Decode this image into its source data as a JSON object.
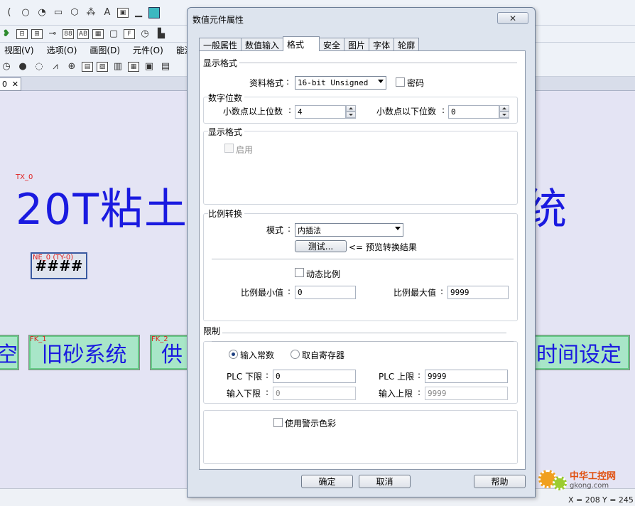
{
  "app": {
    "menu": [
      "视图(V)",
      "选项(O)",
      "画图(D)",
      "元件(O)",
      "能源管理"
    ],
    "tab": {
      "label": "0",
      "close": "✕"
    },
    "canvas": {
      "title_tag": "TX_0",
      "title_text": "20T粘土",
      "title_tail": "统",
      "numeric_tag": "NE_0 (TY-0)",
      "numeric_value": "####",
      "fk_buttons": [
        {
          "tag": "",
          "label": "空"
        },
        {
          "tag": "FK_1",
          "label": "旧砂系统"
        },
        {
          "tag": "FK_2",
          "label": "供"
        },
        {
          "tag": "",
          "label": "时间设定"
        }
      ]
    },
    "status": {
      "x": "X = 208",
      "y": "Y = 245"
    },
    "watermark": {
      "cn": "中华工控网",
      "en": "gkong.com"
    }
  },
  "dialog": {
    "title": "数值元件属性",
    "close_icon": "close-icon",
    "tabs": [
      {
        "label": "一般属性",
        "active": false
      },
      {
        "label": "数值输入",
        "active": false
      },
      {
        "label": "格式",
        "active": true
      },
      {
        "label": "安全",
        "active": false
      },
      {
        "label": "图片",
        "active": false
      },
      {
        "label": "字体",
        "active": false
      },
      {
        "label": "轮廓",
        "active": false
      }
    ],
    "display_format": {
      "section": "显示格式",
      "data_format_label": "资料格式",
      "data_format_value": "16-bit Unsigned",
      "password_label": "密码"
    },
    "digits": {
      "section": "数字位数",
      "left_label": "小数点以上位数",
      "left_value": "4",
      "right_label": "小数点以下位数",
      "right_value": "0"
    },
    "display_format2": {
      "section": "显示格式",
      "enable_label": "启用"
    },
    "scaling": {
      "section": "比例转换",
      "mode_label": "模式",
      "mode_value": "内插法",
      "test_button": "测试...",
      "preview_text": "<= 预览转换结果",
      "dynamic_label": "动态比例",
      "min_label": "比例最小值",
      "min_value": "0",
      "max_label": "比例最大值",
      "max_value": "9999"
    },
    "limits": {
      "section": "限制",
      "radio_const": "输入常数",
      "radio_reg": "取自寄存器",
      "plc_low_label": "PLC 下限",
      "plc_low_value": "0",
      "plc_high_label": "PLC 上限",
      "plc_high_value": "9999",
      "in_low_label": "输入下限",
      "in_low_value": "0",
      "in_high_label": "输入上限",
      "in_high_value": "9999"
    },
    "warning": {
      "label": "使用警示色彩"
    },
    "buttons": {
      "ok": "确定",
      "cancel": "取消",
      "help": "帮助"
    }
  }
}
